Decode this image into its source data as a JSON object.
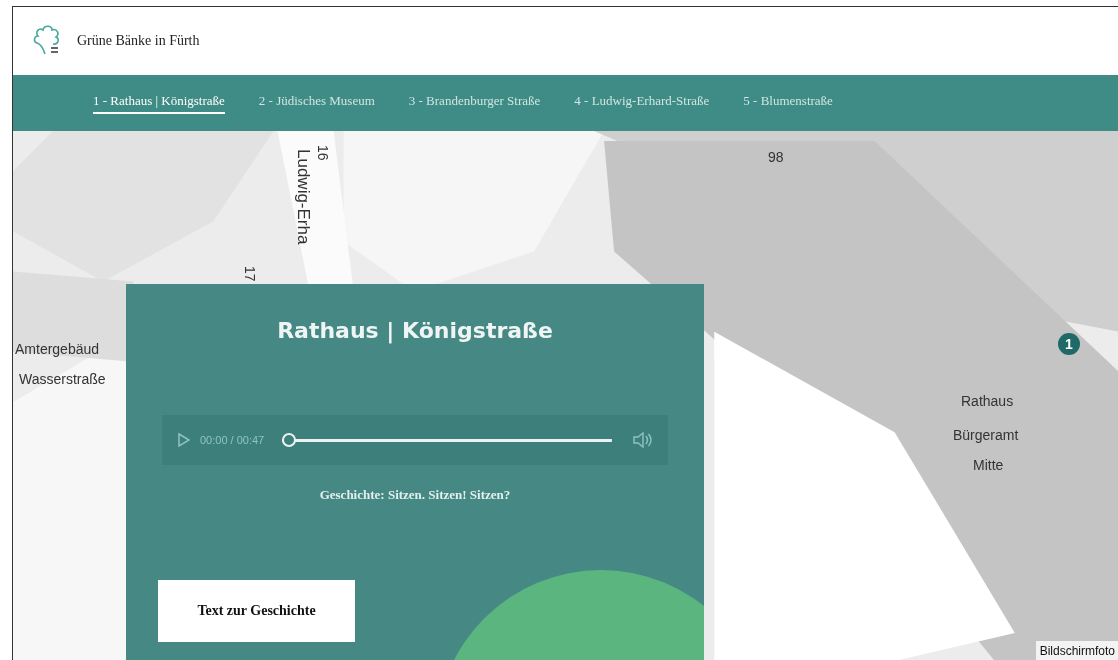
{
  "header": {
    "title": "Grüne Bänke in Fürth"
  },
  "nav": [
    {
      "label": "1 - Rathaus | Königstraße",
      "selected": true
    },
    {
      "label": "2 - Jüdisches Museum",
      "selected": false
    },
    {
      "label": "3 - Brandenburger Straße",
      "selected": false
    },
    {
      "label": "4 - Ludwig-Erhard-Straße",
      "selected": false
    },
    {
      "label": "5 - Blumenstraße",
      "selected": false
    }
  ],
  "map": {
    "labels": [
      {
        "text": "Ludwig-Erha",
        "kind": "street"
      },
      {
        "text": "16",
        "kind": "number"
      },
      {
        "text": "17",
        "kind": "number"
      },
      {
        "text": "98",
        "kind": "number"
      },
      {
        "text": "Amtergebäud",
        "kind": "place"
      },
      {
        "text": "Wasserstraße",
        "kind": "place"
      },
      {
        "text": "Rathaus",
        "kind": "place"
      },
      {
        "text": "Bürgeramt",
        "kind": "place"
      },
      {
        "text": "Mitte",
        "kind": "place"
      }
    ],
    "marker": {
      "label": "1"
    },
    "caption": "Bildschirmfoto"
  },
  "panel": {
    "title": "Rathaus | Königstraße",
    "player": {
      "time": "00:00 / 00:47",
      "level": 0
    },
    "story_title": "Geschichte: Sitzen. Sitzen! Sitzen?",
    "button": "Text zur Geschichte"
  }
}
